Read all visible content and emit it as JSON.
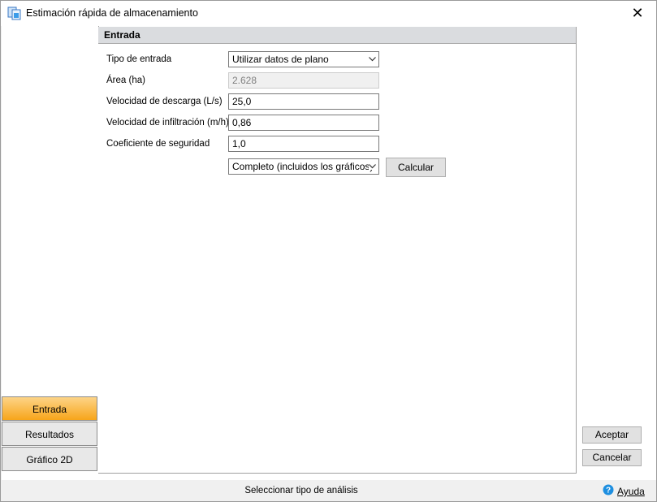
{
  "window": {
    "title": "Estimación rápida de almacenamiento",
    "close_glyph": "✕"
  },
  "nav": {
    "items": [
      "Entrada",
      "Resultados",
      "Gráfico 2D"
    ],
    "active": "Entrada"
  },
  "panel": {
    "header": "Entrada",
    "fields": {
      "tipo_label": "Tipo de entrada",
      "tipo_value": "Utilizar datos de plano",
      "area_label": "Área (ha)",
      "area_value": "2.628",
      "descarga_label": "Velocidad de descarga (L/s)",
      "descarga_value": "25,0",
      "infiltracion_label": "Velocidad de infiltración (m/h)",
      "infiltracion_value": "0,86",
      "seguridad_label": "Coeficiente de seguridad",
      "seguridad_value": "1,0",
      "modo_value": "Completo (incluidos los gráficos)"
    },
    "calcular_label": "Calcular"
  },
  "actions": {
    "aceptar": "Aceptar",
    "cancelar": "Cancelar"
  },
  "status": {
    "text": "Seleccionar tipo de análisis",
    "help": "Ayuda"
  },
  "colors": {
    "active_tab": "#f7a51a",
    "header_bg": "#dadcdf",
    "help_icon": "#1e8fe0"
  }
}
